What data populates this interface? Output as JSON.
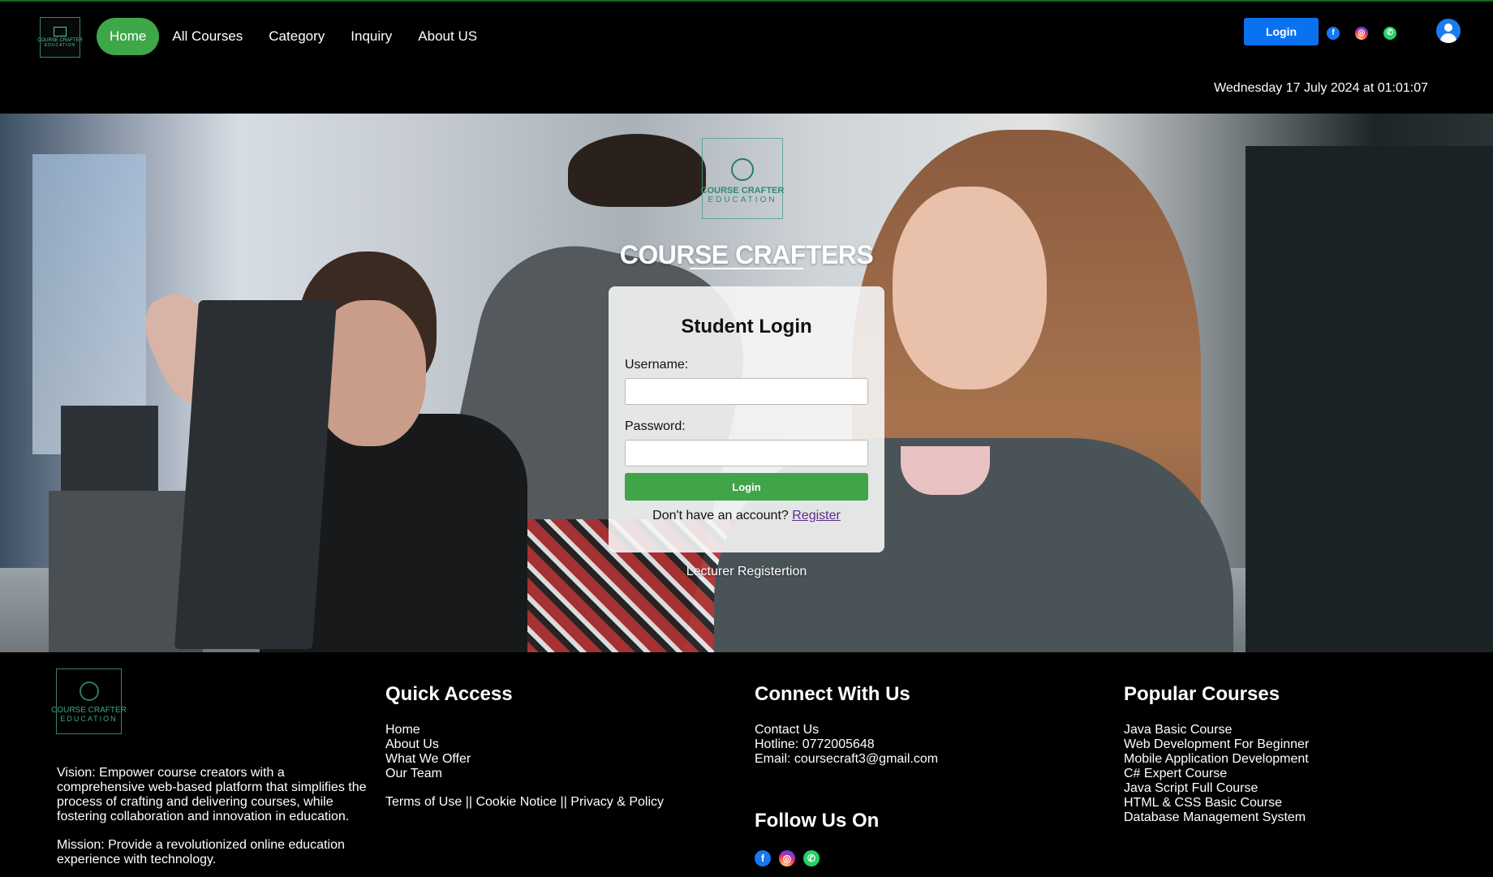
{
  "brand": {
    "logo_line1": "COURSE CRAFTER",
    "logo_line2": "EDUCATION",
    "title": "COURSE CRAFTERS"
  },
  "nav": {
    "items": [
      {
        "label": "Home",
        "active": true
      },
      {
        "label": "All Courses",
        "active": false
      },
      {
        "label": "Category",
        "active": false
      },
      {
        "label": "Inquiry",
        "active": false
      },
      {
        "label": "About US",
        "active": false
      }
    ],
    "login_label": "Login",
    "social_icons": [
      "facebook-icon",
      "instagram-icon",
      "whatsapp-icon"
    ],
    "user_icon": "user-account-icon"
  },
  "datetime": "Wednesday 17 July 2024 at 01:01:07",
  "login_card": {
    "title": "Student Login",
    "username_label": "Username:",
    "username_value": "",
    "password_label": "Password:",
    "password_value": "",
    "login_label": "Login",
    "no_account_text": "Don't have an account?",
    "register_link": "Register"
  },
  "lecturer_link": "Lecturer Registertion",
  "footer": {
    "vision": "Vision: Empower course creators with a comprehensive web-based platform that simplifies the process of crafting and delivering courses, while fostering collaboration and innovation in education.",
    "mission": "Mission: Provide a revolutionized online education experience with technology.",
    "quick_access": {
      "heading": "Quick Access",
      "links": [
        "Home",
        "About Us",
        "What We Offer",
        "Our Team"
      ],
      "terms": "Terms of Use",
      "cookie": "Cookie Notice",
      "privacy": "Privacy & Policy",
      "separator": "||"
    },
    "connect": {
      "heading": "Connect With Us",
      "lines": [
        "Contact Us",
        "Hotline: 0772005648",
        "Email: coursecraft3@gmail.com"
      ]
    },
    "follow": {
      "heading": "Follow Us On"
    },
    "popular": {
      "heading": "Popular Courses",
      "courses": [
        "Java Basic Course",
        "Web Development For Beginner",
        "Mobile Application Development",
        "C# Expert Course",
        "Java Script Full Course",
        "HTML & CSS Basic Course",
        "Database Management System"
      ]
    }
  },
  "colors": {
    "nav_active": "#3ea848",
    "login_blue": "#0a72f0",
    "card_login_green": "#3fa548",
    "register_link": "#5b2a86"
  }
}
